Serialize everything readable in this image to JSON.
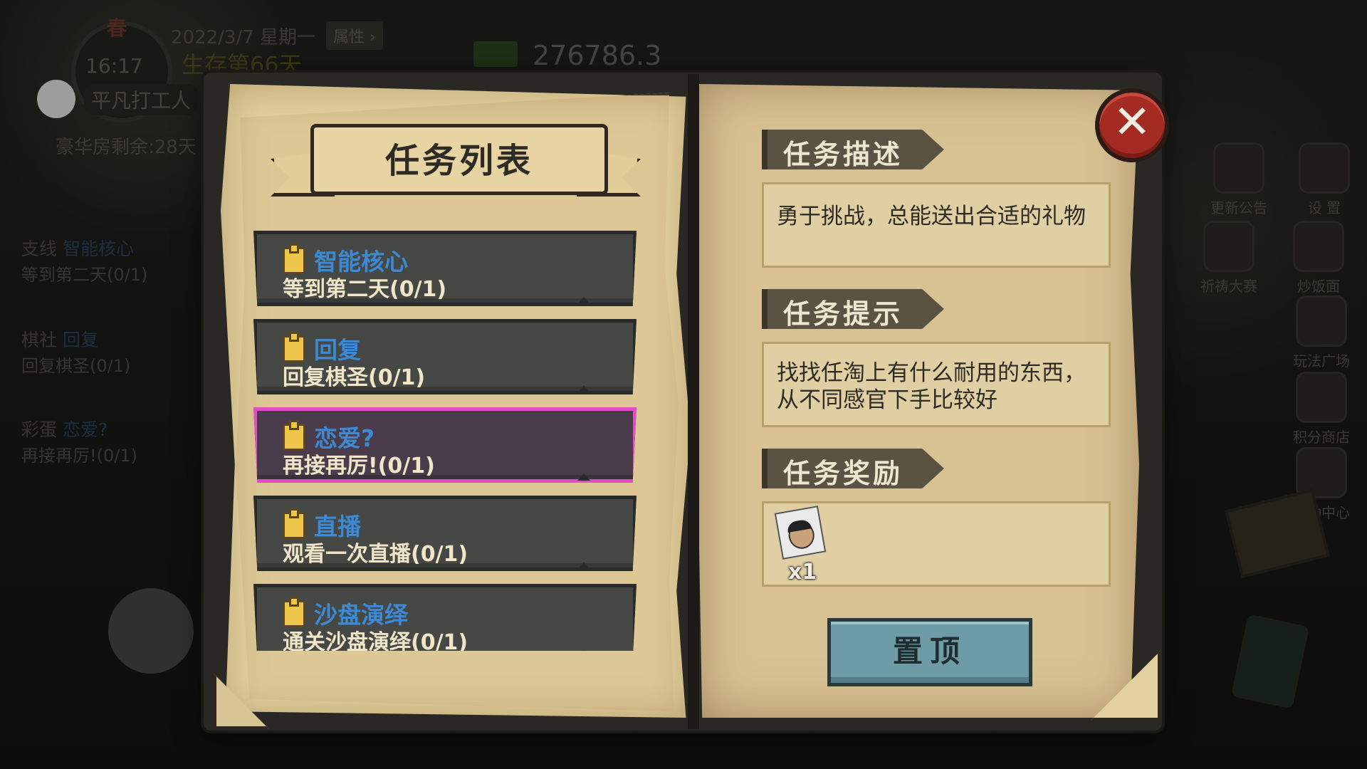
{
  "hud": {
    "season": "春",
    "time": "16:17",
    "date": "2022/3/7 星期一",
    "attributes_label": "属性 ›",
    "survival_days": "生存第66天",
    "money": "276786.3",
    "job": "平凡打工人",
    "luxury_room": "豪华房剩余:28天",
    "side_tasks": [
      {
        "tag": "支线",
        "title": "智能核心",
        "desc": "等到第二天(0/1)"
      },
      {
        "tag": "棋社",
        "title": "回复",
        "desc": "回复棋圣(0/1)"
      },
      {
        "tag": "彩蛋",
        "title": "恋爱?",
        "desc": "再接再厉!(0/1)"
      }
    ],
    "right_icons": [
      {
        "name": "更新公告"
      },
      {
        "name": "设 置"
      },
      {
        "name": "祈祷大赛"
      },
      {
        "name": "炒饭面"
      },
      {
        "name": "玩法广场"
      },
      {
        "name": "积分商店"
      },
      {
        "name": "活动中心"
      }
    ]
  },
  "dialog": {
    "title": "任务列表",
    "tasks": [
      {
        "name": "智能核心",
        "desc": "等到第二天(0/1)",
        "selected": false
      },
      {
        "name": "回复",
        "desc": "回复棋圣(0/1)",
        "selected": false
      },
      {
        "name": "恋爱?",
        "desc": "再接再厉!(0/1)",
        "selected": true
      },
      {
        "name": "直播",
        "desc": "观看一次直播(0/1)",
        "selected": false
      },
      {
        "name": "沙盘演绎",
        "desc": "通关沙盘演绎(0/1)",
        "selected": false
      }
    ],
    "description_header": "任务描述",
    "description_text": "勇于挑战，总能送出合适的礼物",
    "hint_header": "任务提示",
    "hint_text": "找找任淘上有什么耐用的东西，从不同感官下手比较好",
    "reward_header": "任务奖励",
    "reward_item_icon": "magazine-portrait-icon",
    "reward_qty": "x1",
    "pin_button": "置顶",
    "close_icon": "close-x-icon"
  },
  "colors": {
    "task_name": "#3c8ad4",
    "task_selected_border": "#e24cc4",
    "close_button": "#a32b22",
    "pin_button": "#6e9ca6"
  }
}
